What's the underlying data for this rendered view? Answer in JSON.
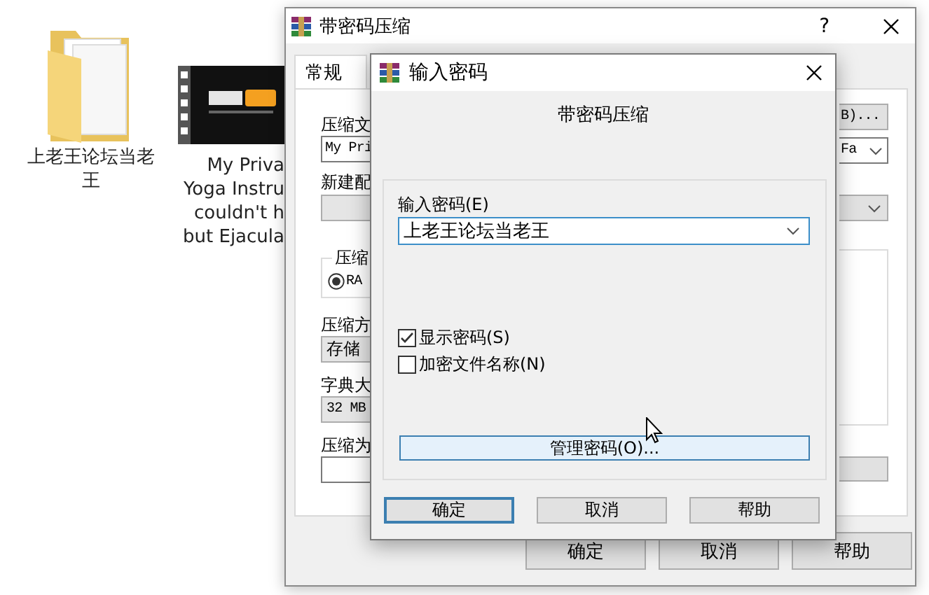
{
  "desktop_icons": [
    {
      "kind": "folder",
      "label": "上老王论坛当老王"
    },
    {
      "kind": "video",
      "label": "My Priva\nYoga Instru\ncouldn't h\nbut Ejacula"
    }
  ],
  "back_window": {
    "title": "带密码压缩",
    "help": "?",
    "tabs": [
      {
        "label": "常规",
        "selected": true
      }
    ],
    "archive_name_label": "压缩文",
    "archive_name": "My Pri",
    "browse_button": "B)...",
    "update_mode": "Fa",
    "profile_label": "新建配",
    "format_group": {
      "legend": "压缩",
      "option": "RA",
      "selected": true
    },
    "method_label": "压缩方",
    "method": "存储",
    "dictionary_label": "字典大",
    "dictionary": "32 MB",
    "split_label": "压缩为",
    "buttons": [
      "确定",
      "取消",
      "帮助"
    ]
  },
  "dialog": {
    "title": "输入密码",
    "heading": "带密码压缩",
    "password_label": "输入密码(E)",
    "password": "上老王论坛当老王",
    "options": [
      {
        "label": "显示密码(S)",
        "checked": true
      },
      {
        "label": "加密文件名称(N)",
        "checked": false
      }
    ],
    "manage_button": "管理密码(O)...",
    "buttons": [
      {
        "label": "确定",
        "focused": true
      },
      {
        "label": "取消",
        "focused": false
      },
      {
        "label": "帮助",
        "focused": false
      }
    ]
  }
}
